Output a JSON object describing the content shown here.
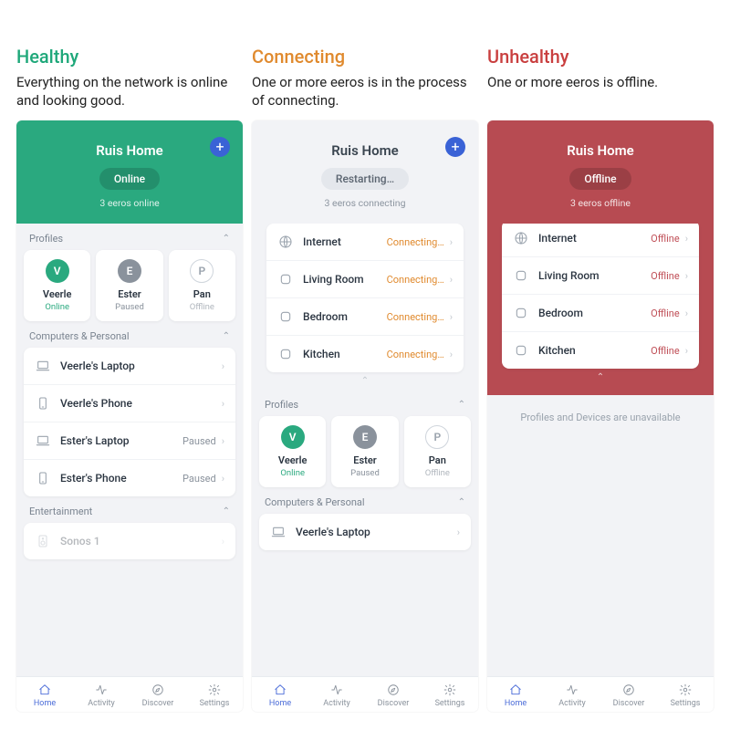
{
  "columns": [
    {
      "title": "Healthy",
      "title_class": "green",
      "desc": "Everything on the network is online and looking good.",
      "hero": {
        "class": "green",
        "title": "Ruis Home",
        "pill": "Online",
        "pill_class": "dark-green",
        "sub": "3 eeros online",
        "plus": true
      },
      "sections": [
        {
          "type": "profiles",
          "head": "Profiles",
          "items": [
            {
              "initial": "V",
              "avatar_class": "g",
              "name": "Veerle",
              "status": "Online",
              "status_class": "st-online"
            },
            {
              "initial": "E",
              "avatar_class": "gr",
              "name": "Ester",
              "status": "Paused",
              "status_class": "st-paused"
            },
            {
              "initial": "P",
              "avatar_class": "outline",
              "name": "Pan",
              "status": "Offline",
              "status_class": "st-offline"
            }
          ]
        },
        {
          "type": "list",
          "head": "Computers & Personal",
          "items": [
            {
              "icon": "laptop",
              "label": "Veerle's Laptop",
              "status": "",
              "status_class": "wifi-icon",
              "wifi": true
            },
            {
              "icon": "phone",
              "label": "Veerle's Phone",
              "status": "",
              "status_class": "wifi-icon",
              "wifi": true
            },
            {
              "icon": "laptop",
              "label": "Ester's Laptop",
              "status": "Paused",
              "status_class": "st-paused"
            },
            {
              "icon": "phone",
              "label": "Ester's Phone",
              "status": "Paused",
              "status_class": "st-paused"
            }
          ]
        },
        {
          "type": "list",
          "head": "Entertainment",
          "items": [
            {
              "icon": "speaker",
              "label": "Sonos 1",
              "status": "",
              "status_class": "wifi-icon",
              "wifi": true,
              "faded": true
            }
          ]
        }
      ]
    },
    {
      "title": "Connecting",
      "title_class": "orange",
      "desc": "One or more eeros is in the process of connecting.",
      "hero": {
        "class": "white",
        "title": "Ruis Home",
        "pill": "Restarting…",
        "pill_class": "grey",
        "sub": "3 eeros connecting",
        "plus": true
      },
      "nodes": {
        "items": [
          {
            "icon": "globe",
            "label": "Internet",
            "status": "Connecting…",
            "status_class": "st-connecting"
          },
          {
            "icon": "node",
            "label": "Living Room",
            "status": "Connecting…",
            "status_class": "st-connecting"
          },
          {
            "icon": "node",
            "label": "Bedroom",
            "status": "Connecting…",
            "status_class": "st-connecting"
          },
          {
            "icon": "node",
            "label": "Kitchen",
            "status": "Connecting…",
            "status_class": "st-connecting"
          }
        ]
      },
      "sections": [
        {
          "type": "profiles",
          "head": "Profiles",
          "items": [
            {
              "initial": "V",
              "avatar_class": "g",
              "name": "Veerle",
              "status": "Online",
              "status_class": "st-online"
            },
            {
              "initial": "E",
              "avatar_class": "gr",
              "name": "Ester",
              "status": "Paused",
              "status_class": "st-paused"
            },
            {
              "initial": "P",
              "avatar_class": "outline",
              "name": "Pan",
              "status": "Offline",
              "status_class": "st-offline"
            }
          ]
        },
        {
          "type": "list",
          "head": "Computers & Personal",
          "items": [
            {
              "icon": "laptop",
              "label": "Veerle's Laptop",
              "status": "",
              "status_class": "wifi-icon",
              "wifi": true
            }
          ]
        }
      ]
    },
    {
      "title": "Unhealthy",
      "title_class": "red",
      "desc": "One or more eeros is offline.",
      "hero": {
        "class": "red",
        "title": "Ruis Home",
        "pill": "Offline",
        "pill_class": "dark-red",
        "sub": "3 eeros offline",
        "plus": false
      },
      "nodes_in_hero": true,
      "nodes": {
        "items": [
          {
            "icon": "globe",
            "label": "Internet",
            "status": "Offline",
            "status_class": "st-off-red"
          },
          {
            "icon": "node",
            "label": "Living Room",
            "status": "Offline",
            "status_class": "st-off-red"
          },
          {
            "icon": "node",
            "label": "Bedroom",
            "status": "Offline",
            "status_class": "st-off-red"
          },
          {
            "icon": "node",
            "label": "Kitchen",
            "status": "Offline",
            "status_class": "st-off-red"
          }
        ]
      },
      "note": "Profiles and Devices are unavailable"
    }
  ],
  "tabs": [
    {
      "icon": "home",
      "label": "Home",
      "active": true
    },
    {
      "icon": "activity",
      "label": "Activity"
    },
    {
      "icon": "discover",
      "label": "Discover"
    },
    {
      "icon": "settings",
      "label": "Settings"
    }
  ]
}
